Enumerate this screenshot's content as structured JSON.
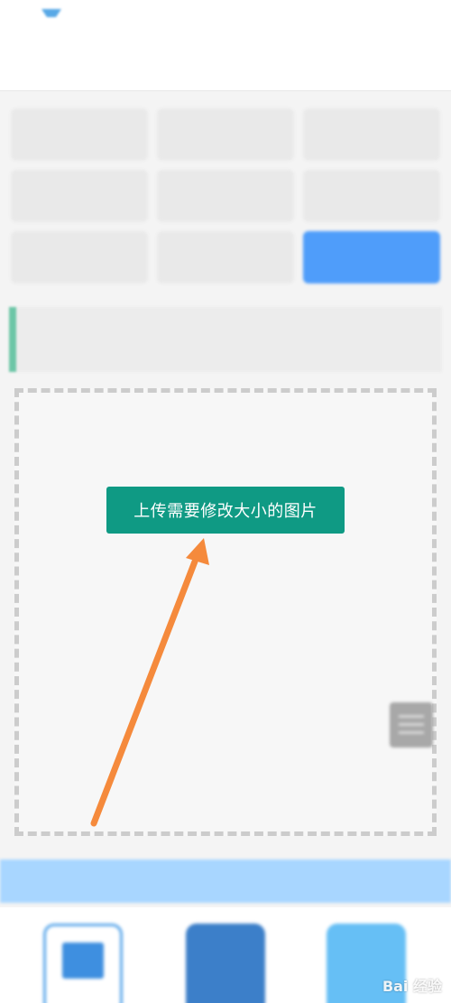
{
  "header": {
    "carrier": "",
    "status_right": "",
    "title": ""
  },
  "tools": [
    {
      "label": ""
    },
    {
      "label": ""
    },
    {
      "label": ""
    },
    {
      "label": ""
    },
    {
      "label": ""
    },
    {
      "label": ""
    },
    {
      "label": ""
    },
    {
      "label": ""
    },
    {
      "label": ""
    }
  ],
  "notice": {
    "text": ""
  },
  "upload": {
    "button_label": "上传需要修改大小的图片"
  },
  "banner": {
    "text": ""
  },
  "watermark": {
    "text": "Bai 经验"
  },
  "colors": {
    "primary": "#0f9a84",
    "active_tab": "#4f9dfa",
    "arrow": "#f58a3c",
    "banner": "#a8d6ff"
  },
  "icons": {
    "signal": "signal-icon",
    "crop": "crop-image-icon",
    "phone": "phone-app-icon",
    "bubble": "chat-bubble-icon",
    "handle": "menu-handle-icon",
    "arrow": "pointer-arrow-icon"
  }
}
